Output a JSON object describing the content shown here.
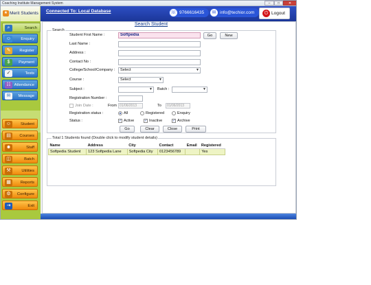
{
  "window": {
    "title": "Coaching Institute Management System",
    "controls": [
      "–",
      "□",
      "✕"
    ]
  },
  "brand": {
    "name": "Merit Students"
  },
  "header": {
    "connection": "Connected To: Local Database",
    "phone": "9766616435",
    "email": "info@techior.com",
    "logout": "Logout"
  },
  "sidebar": {
    "items": [
      {
        "label": "Search",
        "icon": "search-icon",
        "style": "blue"
      },
      {
        "label": "Enquiry",
        "icon": "person-icon",
        "style": "blue"
      },
      {
        "label": "Register",
        "icon": "register-icon",
        "style": "blue"
      },
      {
        "label": "Payment",
        "icon": "payment-icon",
        "style": "blue"
      },
      {
        "label": "Tests",
        "icon": "tests-icon",
        "style": "blue"
      },
      {
        "label": "Attendance",
        "icon": "attendance-icon",
        "style": "blue"
      },
      {
        "label": "Message",
        "icon": "message-icon",
        "style": "blue"
      },
      {
        "label": "Student",
        "icon": "student-icon",
        "style": "orange"
      },
      {
        "label": "Courses",
        "icon": "courses-icon",
        "style": "orange"
      },
      {
        "label": "Staff",
        "icon": "staff-icon",
        "style": "orange"
      },
      {
        "label": "Batch",
        "icon": "batch-icon",
        "style": "orange"
      },
      {
        "label": "Utilities",
        "icon": "utilities-icon",
        "style": "orange"
      },
      {
        "label": "Reports",
        "icon": "reports-icon",
        "style": "orange"
      },
      {
        "label": "Configure",
        "icon": "configure-icon",
        "style": "orange"
      },
      {
        "label": "Exit",
        "icon": "exit-icon",
        "style": "orange"
      }
    ]
  },
  "main": {
    "title": "Search Student",
    "search_group": "Search",
    "labels": {
      "first_name": "Student First Name :",
      "last_name": "Last Name :",
      "address": "Address :",
      "contact": "Contact No :",
      "college": "College/School/Company :",
      "course": "Course :",
      "subject": "Subject :",
      "batch": "Batch :",
      "reg_number": "Registration Number :",
      "join_date": "Join Date :",
      "from": "From",
      "to": "To",
      "reg_status": "Registration status :",
      "status": "Status :"
    },
    "values": {
      "first_name": "Softpedia",
      "college": "Select",
      "course": "Select",
      "from_date": "01/06/2013",
      "to_date": "01/06/2013"
    },
    "buttons": {
      "go_top": "Go",
      "new": "New",
      "go": "Go",
      "clear": "Clear",
      "close": "Close",
      "print": "Print"
    },
    "reg_status_options": [
      "All",
      "Registered",
      "Enquiry"
    ],
    "reg_status_selected": "All",
    "status_options": [
      {
        "label": "Active",
        "checked": true
      },
      {
        "label": "Inactive",
        "checked": true
      },
      {
        "label": "Archive",
        "checked": true
      }
    ],
    "results": {
      "caption": "Total 1 Students found (Double click to modify student details)",
      "columns": [
        "Name",
        "Address",
        "City",
        "Contact",
        "Email",
        "Registered"
      ],
      "rows": [
        [
          "Softpedia Student",
          "123 Softpedia Lane",
          "Softpedia City",
          "0123456789",
          "",
          "Yes"
        ]
      ]
    }
  }
}
